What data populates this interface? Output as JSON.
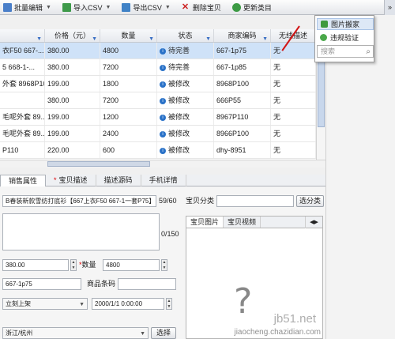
{
  "toolbar": {
    "items": [
      {
        "label": "批量编辑",
        "has_menu": true
      },
      {
        "label": "导入CSV",
        "has_menu": true
      },
      {
        "label": "导出CSV",
        "has_menu": true
      },
      {
        "label": "删除宝贝",
        "has_menu": false
      },
      {
        "label": "更新类目",
        "has_menu": false
      }
    ],
    "more_label": "»"
  },
  "grid": {
    "columns": [
      "",
      "价格（元）",
      "数量",
      "状态",
      "商家编码",
      "无线描述"
    ],
    "rows": [
      {
        "title": "衣F50 667-...",
        "price": "380.00",
        "qty": "4800",
        "status": "待完善",
        "code": "667-1p75",
        "wireless": "无",
        "selected": true
      },
      {
        "title": "5 668-1-...",
        "price": "380.00",
        "qty": "7200",
        "status": "待完善",
        "code": "667-1p85",
        "wireless": "无",
        "selected": false
      },
      {
        "title": "外套 8968P10...",
        "price": "199.00",
        "qty": "1800",
        "status": "被修改",
        "code": "8968P100",
        "wireless": "无",
        "selected": false
      },
      {
        "title": "",
        "price": "380.00",
        "qty": "7200",
        "status": "被修改",
        "code": "666P55",
        "wireless": "无",
        "selected": false
      },
      {
        "title": "毛呢外套 89...",
        "price": "199.00",
        "qty": "1200",
        "status": "被修改",
        "code": "8967P110",
        "wireless": "无",
        "selected": false
      },
      {
        "title": "毛呢外套 89...",
        "price": "199.00",
        "qty": "2400",
        "status": "被修改",
        "code": "8966P100",
        "wireless": "无",
        "selected": false
      },
      {
        "title": "P110",
        "price": "220.00",
        "qty": "600",
        "status": "被修改",
        "code": "dhy-8951",
        "wireless": "无",
        "selected": false
      }
    ]
  },
  "popup_menu": {
    "items": [
      "图片搬家",
      "违规验证"
    ],
    "search_placeholder": "搜索"
  },
  "tabs": [
    {
      "label": "销售属性",
      "required": false
    },
    {
      "label": "宝贝描述",
      "required": true
    },
    {
      "label": "描述源码",
      "required": false
    },
    {
      "label": "手机详情",
      "required": false
    }
  ],
  "form": {
    "title_value": "B春装新款雪纺打底衫【667上衣F50 667-1一套P75】",
    "title_counter": "59/60",
    "desc_counter": "0/150",
    "price_value": "380.00",
    "qty_label": "数量",
    "qty_value": "4800",
    "code_value": "667-1p75",
    "barcode_label": "商品条码",
    "barcode_value": "",
    "shelf_value": "立刻上架",
    "date_value": "2000/1/1 0:00:00",
    "location_value": "浙江/杭州",
    "location_button": "选择"
  },
  "right_panel": {
    "category_label": "宝贝分类",
    "category_value": "",
    "category_button": "选分类",
    "media_tabs": [
      "宝贝图片",
      "宝贝视频"
    ],
    "media_nav": "◀▶",
    "placeholder_glyph": "?"
  },
  "watermarks": {
    "line1": "jb51.net",
    "line2": "jiaocheng.chazidian.com"
  },
  "colors": {
    "selected_row": "#cfe2f8",
    "status_icon": "#2a72c8",
    "required_mark": "#dd0000",
    "arrow": "#d21515"
  }
}
